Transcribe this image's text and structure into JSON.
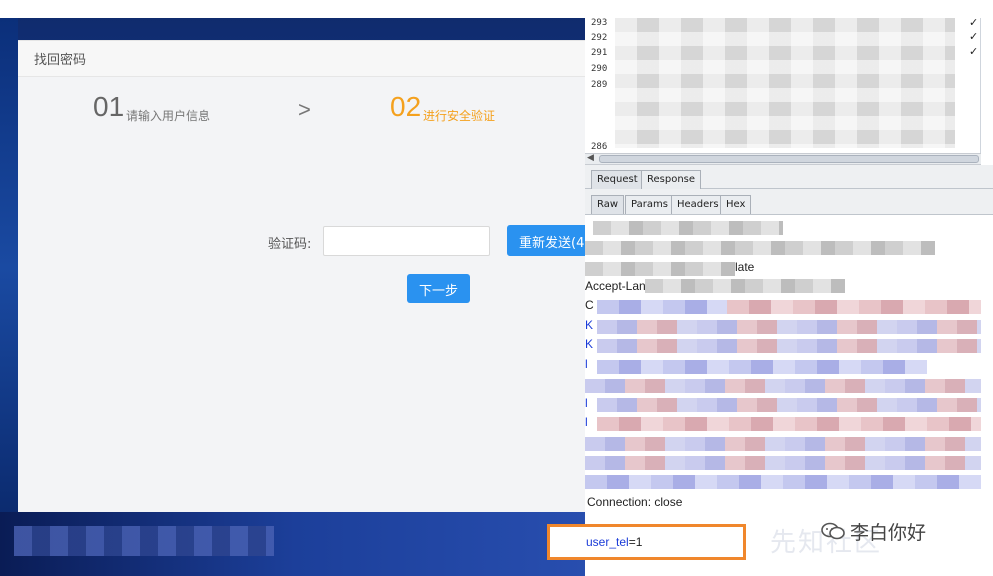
{
  "dialog": {
    "title": "找回密码",
    "step1_num": "01",
    "step1_label": "请输入用户信息",
    "arrow": ">",
    "step2_num": "02",
    "step2_label": "进行安全验证",
    "code_label": "验证码:",
    "code_value": "",
    "resend_label": "重新发送(4",
    "next_label": "下一步"
  },
  "burp": {
    "history_rows": [
      "293",
      "292",
      "291",
      "290",
      "289",
      "286"
    ],
    "checks": [
      "✓",
      "✓",
      "✓"
    ],
    "request_tabs": [
      "Request",
      "Response"
    ],
    "view_tabs": [
      "Raw",
      "Params",
      "Headers",
      "Hex"
    ],
    "raw_lines": {
      "date_fragment": "late",
      "accept": "Accept-Lan",
      "c_line": "C",
      "k1": "K",
      "k2": "K",
      "l1": "l",
      "l2": "l",
      "l3": "l"
    },
    "connection": "Connection: close",
    "param_key": "user_tel",
    "param_eq": "=",
    "param_val": "1"
  },
  "watermark": {
    "name": "李白你好",
    "faint": "先知社区"
  },
  "colors": {
    "accent_blue": "#2a92f0",
    "step_orange": "#f4a11e",
    "highlight_orange": "#f0872c",
    "param_blue": "#1a3bd8"
  }
}
